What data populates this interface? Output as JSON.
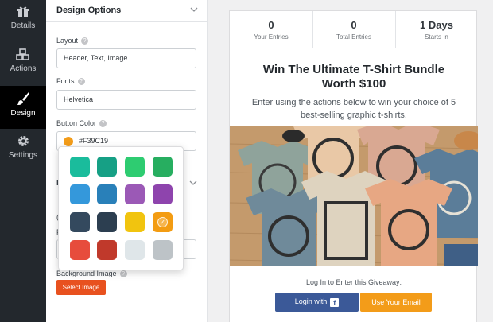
{
  "sidebar": {
    "items": [
      {
        "label": "Details",
        "icon": "gift-icon"
      },
      {
        "label": "Actions",
        "icon": "cubes-icon"
      },
      {
        "label": "Design",
        "icon": "paintbrush-icon"
      },
      {
        "label": "Settings",
        "icon": "gear-icon"
      }
    ],
    "active": "Design"
  },
  "design_options": {
    "section_title": "Design Options",
    "layout": {
      "label": "Layout",
      "value": "Header, Text, Image"
    },
    "fonts": {
      "label": "Fonts",
      "value": "Helvetica"
    },
    "button_color": {
      "label": "Button Color",
      "value": "#F39C19"
    },
    "partial_p1": "P",
    "partial_c": "(",
    "partial_p2": "P",
    "background_image": {
      "label": "Background Image",
      "button": "Select Image"
    }
  },
  "color_picker": {
    "colors": [
      "#1abc9c",
      "#16a085",
      "#2ecc71",
      "#27ae60",
      "#3498db",
      "#2980b9",
      "#9b59b6",
      "#8e44ad",
      "#34495e",
      "#2c3e50",
      "#f1c40f",
      "#f39c12",
      "#e74c3c",
      "#c0392b",
      "#dfe6e9",
      "#bdc3c7"
    ],
    "selected": "#f39c12"
  },
  "preview": {
    "stats": [
      {
        "value": "0",
        "label": "Your Entries"
      },
      {
        "value": "0",
        "label": "Total Entries"
      },
      {
        "value": "1 Days",
        "label": "Starts In"
      }
    ],
    "title_line1": "Win The Ultimate T-Shirt Bundle",
    "title_line2": "Worth $100",
    "desc_line1": "Enter using the actions below to win your choice of 5",
    "desc_line2": "best-selling graphic t-shirts.",
    "login_prompt": "Log In to Enter this Giveaway:",
    "facebook_button": "Login with",
    "facebook_icon_letter": "f",
    "email_button": "Use Your Email"
  }
}
